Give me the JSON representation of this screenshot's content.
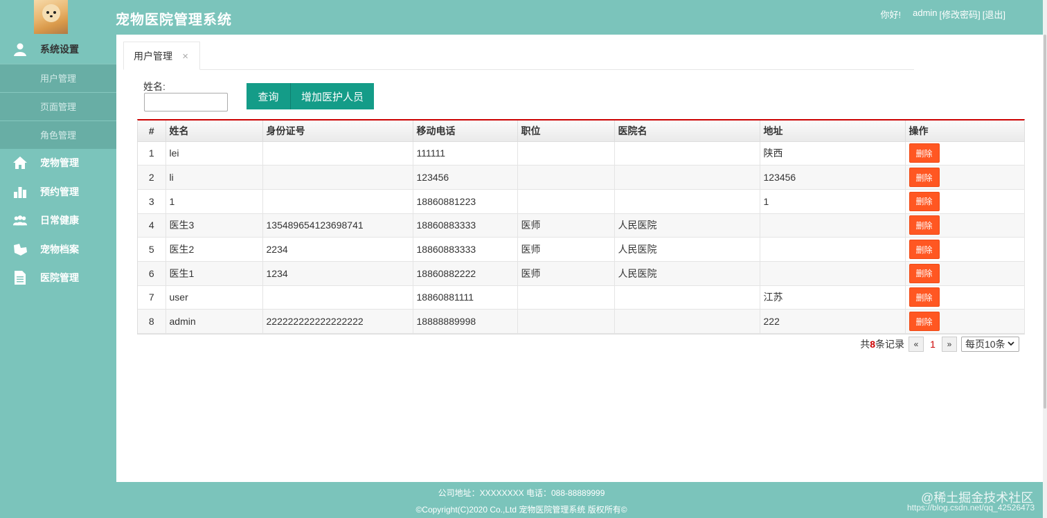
{
  "header": {
    "title": "宠物医院管理系统",
    "greeting": "你好!",
    "username": "admin",
    "change_password": "[修改密码]",
    "logout": "[退出]"
  },
  "sidebar": {
    "items": [
      {
        "label": "系统设置",
        "icon": "user-icon"
      },
      {
        "label": "宠物管理",
        "icon": "home-icon"
      },
      {
        "label": "预约管理",
        "icon": "bar-chart-icon"
      },
      {
        "label": "日常健康",
        "icon": "group-icon"
      },
      {
        "label": "宠物档案",
        "icon": "pet-record-icon"
      },
      {
        "label": "医院管理",
        "icon": "document-icon"
      }
    ],
    "sub_items": [
      "用户管理",
      "页面管理",
      "角色管理"
    ]
  },
  "tabs": [
    {
      "label": "用户管理",
      "close": "×"
    }
  ],
  "search": {
    "label": "姓名:",
    "value": "",
    "query_button": "查询",
    "add_button": "增加医护人员"
  },
  "table": {
    "columns": [
      "#",
      "姓名",
      "身份证号",
      "移动电话",
      "职位",
      "医院名",
      "地址",
      "操作"
    ],
    "rows": [
      {
        "num": "1",
        "name": "lei",
        "id": "",
        "phone": "111111",
        "position": "",
        "hospital": "",
        "address": "陕西",
        "action": "删除"
      },
      {
        "num": "2",
        "name": "li",
        "id": "",
        "phone": "123456",
        "position": "",
        "hospital": "",
        "address": "123456",
        "action": "删除"
      },
      {
        "num": "3",
        "name": "1",
        "id": "",
        "phone": "18860881223",
        "position": "",
        "hospital": "",
        "address": "1",
        "action": "删除"
      },
      {
        "num": "4",
        "name": "医生3",
        "id": "135489654123698741",
        "phone": "18860883333",
        "position": "医师",
        "hospital": "人民医院",
        "address": "",
        "action": "删除"
      },
      {
        "num": "5",
        "name": "医生2",
        "id": "2234",
        "phone": "18860883333",
        "position": "医师",
        "hospital": "人民医院",
        "address": "",
        "action": "删除"
      },
      {
        "num": "6",
        "name": "医生1",
        "id": "1234",
        "phone": "18860882222",
        "position": "医师",
        "hospital": "人民医院",
        "address": "",
        "action": "删除"
      },
      {
        "num": "7",
        "name": "user",
        "id": "",
        "phone": "18860881111",
        "position": "",
        "hospital": "",
        "address": "江苏",
        "action": "删除"
      },
      {
        "num": "8",
        "name": "admin",
        "id": "222222222222222222",
        "phone": "18888889998",
        "position": "",
        "hospital": "",
        "address": "222",
        "action": "删除"
      }
    ]
  },
  "pager": {
    "prefix": "共",
    "total": "8",
    "suffix": "条记录",
    "prev": "«",
    "current": "1",
    "next": "»",
    "page_size": "每页10条"
  },
  "footer": {
    "line1": "公司地址：XXXXXXXX 电话：088-88889999",
    "line2": "©Copyright(C)2020 Co.,Ltd 宠物医院管理系统 版权所有©"
  },
  "watermark": {
    "line1": "@稀土掘金技术社区",
    "line2": "https://blog.csdn.net/qq_42526473"
  },
  "colors": {
    "theme": "#7bc4bb",
    "button": "#149c88",
    "delete": "#ff5722",
    "table_accent": "#cc0000"
  }
}
